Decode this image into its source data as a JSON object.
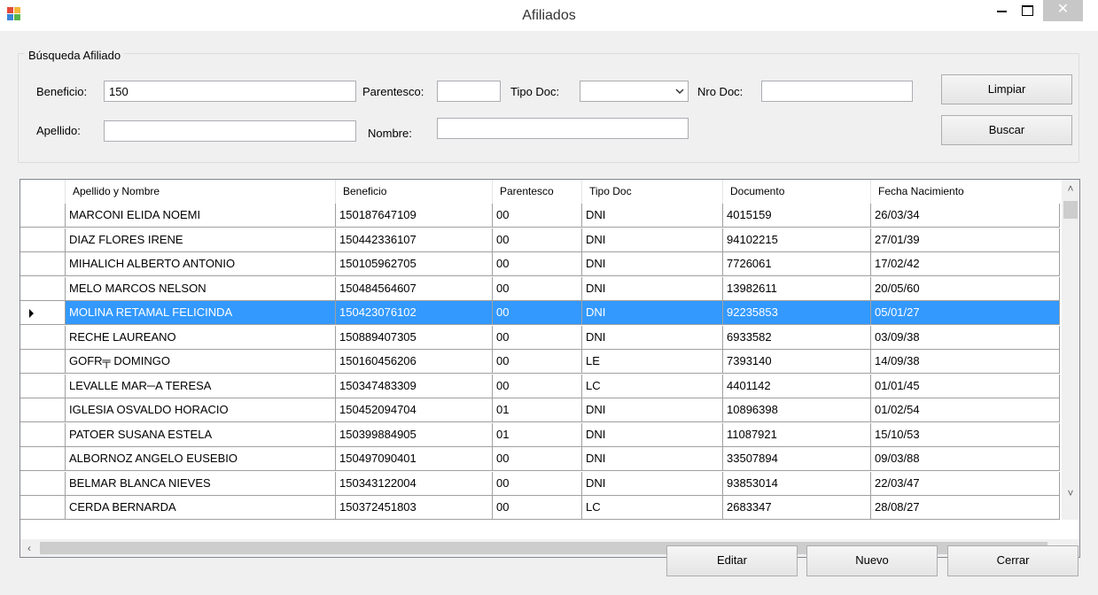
{
  "window": {
    "title": "Afiliados",
    "close_glyph": "✕"
  },
  "search": {
    "group_title": "Búsqueda Afiliado",
    "beneficio_label": "Beneficio:",
    "beneficio_value": "150",
    "parentesco_label": "Parentesco:",
    "parentesco_value": "",
    "tipo_doc_label": "Tipo Doc:",
    "tipo_doc_value": "",
    "nro_doc_label": "Nro Doc:",
    "nro_doc_value": "",
    "apellido_label": "Apellido:",
    "apellido_value": "",
    "nombre_label": "Nombre:",
    "nombre_value": "",
    "limpiar_label": "Limpiar",
    "buscar_label": "Buscar"
  },
  "grid": {
    "columns": [
      "Apellido y Nombre",
      "Beneficio",
      "Parentesco",
      "Tipo Doc",
      "Documento",
      "Fecha Nacimiento"
    ],
    "selected_row": 4,
    "rows": [
      [
        "MARCONI ELIDA NOEMI",
        "150187647109",
        "00",
        "DNI",
        "4015159",
        "26/03/34"
      ],
      [
        "DIAZ FLORES IRENE",
        "150442336107",
        "00",
        "DNI",
        "94102215",
        "27/01/39"
      ],
      [
        "MIHALICH ALBERTO ANTONIO",
        "150105962705",
        "00",
        "DNI",
        "7726061",
        "17/02/42"
      ],
      [
        "MELO MARCOS NELSON",
        "150484564607",
        "00",
        "DNI",
        "13982611",
        "20/05/60"
      ],
      [
        "MOLINA RETAMAL FELICINDA",
        "150423076102",
        "00",
        "DNI",
        "92235853",
        "05/01/27"
      ],
      [
        "RECHE LAUREANO",
        "150889407305",
        "00",
        "DNI",
        "6933582",
        "03/09/38"
      ],
      [
        "GOFR╤ DOMINGO",
        "150160456206",
        "00",
        "LE",
        "7393140",
        "14/09/38"
      ],
      [
        "LEVALLE MAR─A TERESA",
        "150347483309",
        "00",
        "LC",
        "4401142",
        "01/01/45"
      ],
      [
        "IGLESIA OSVALDO HORACIO",
        "150452094704",
        "01",
        "DNI",
        "10896398",
        "01/02/54"
      ],
      [
        "PATOER SUSANA ESTELA",
        "150399884905",
        "01",
        "DNI",
        "11087921",
        "15/10/53"
      ],
      [
        "ALBORNOZ ANGELO EUSEBIO",
        "150497090401",
        "00",
        "DNI",
        "33507894",
        "09/03/88"
      ],
      [
        "BELMAR BLANCA NIEVES",
        "150343122004",
        "00",
        "DNI",
        "93853014",
        "22/03/47"
      ],
      [
        "CERDA BERNARDA",
        "150372451803",
        "00",
        "LC",
        "2683347",
        "28/08/27"
      ]
    ]
  },
  "footer": {
    "editar_label": "Editar",
    "nuevo_label": "Nuevo",
    "cerrar_label": "Cerrar"
  }
}
